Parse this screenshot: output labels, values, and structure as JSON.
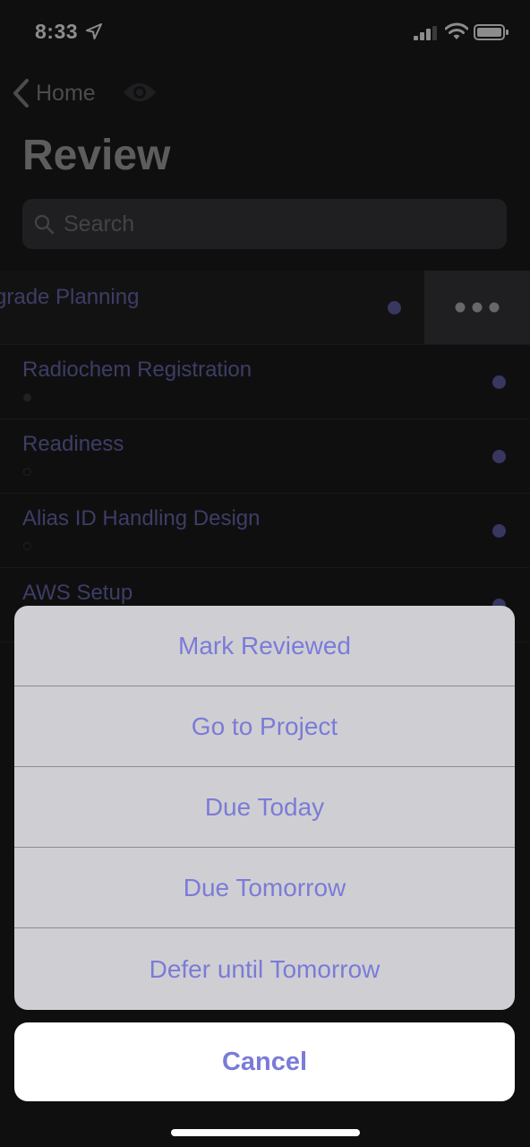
{
  "status_bar": {
    "time": "8:33",
    "icons": [
      "location-arrow-icon",
      "signal-icon",
      "wifi-icon",
      "battery-icon"
    ]
  },
  "nav": {
    "back_label": "Home",
    "title": "Review"
  },
  "search": {
    "placeholder": "Search"
  },
  "rows": [
    {
      "title": "grade Planning",
      "marker": "none",
      "swiped": true,
      "action_icon": "more-icon"
    },
    {
      "title": "Radiochem Registration",
      "marker": "filled"
    },
    {
      "title": "Readiness",
      "marker": "hollow"
    },
    {
      "title": "Alias ID Handling Design",
      "marker": "hollow"
    },
    {
      "title": "AWS Setup",
      "marker": "none"
    }
  ],
  "action_sheet": {
    "options": [
      "Mark Reviewed",
      "Go to Project",
      "Due Today",
      "Due Tomorrow",
      "Defer until Tomorrow"
    ],
    "cancel_label": "Cancel"
  },
  "colors": {
    "accent": "#7b7bd8",
    "row_text": "#6f6fb8",
    "dot": "#6565b0",
    "background": "#1c1c1e",
    "sheet_background": "#cfcfd3"
  }
}
